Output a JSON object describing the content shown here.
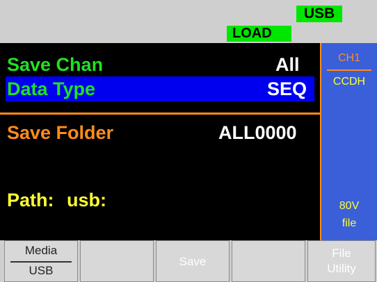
{
  "status": {
    "usb_label": "USB",
    "load_label": "LOAD"
  },
  "main": {
    "save_chan": {
      "label": "Save Chan",
      "value": "All"
    },
    "data_type": {
      "label": "Data Type",
      "value": "SEQ"
    },
    "save_folder": {
      "label": "Save Folder",
      "value": "ALL0000"
    },
    "path": {
      "label": "Path:",
      "value": "usb:"
    }
  },
  "side": {
    "channel": "CH1",
    "mode": "CCDH",
    "voltage": "80V",
    "kind": "file"
  },
  "softkeys": [
    {
      "line1": "Media",
      "line2": "USB"
    },
    {
      "line1": ""
    },
    {
      "line1": "Save"
    },
    {
      "line1": ""
    },
    {
      "line1": "File",
      "line2": "Utility"
    }
  ],
  "colors": {
    "label_green": "#22e022",
    "label_orange": "#ff8c1a",
    "label_yellow": "#ffff33",
    "highlight_blue": "#0000ee",
    "side_blue": "#3a5fd9",
    "badge_green": "#00e600"
  }
}
